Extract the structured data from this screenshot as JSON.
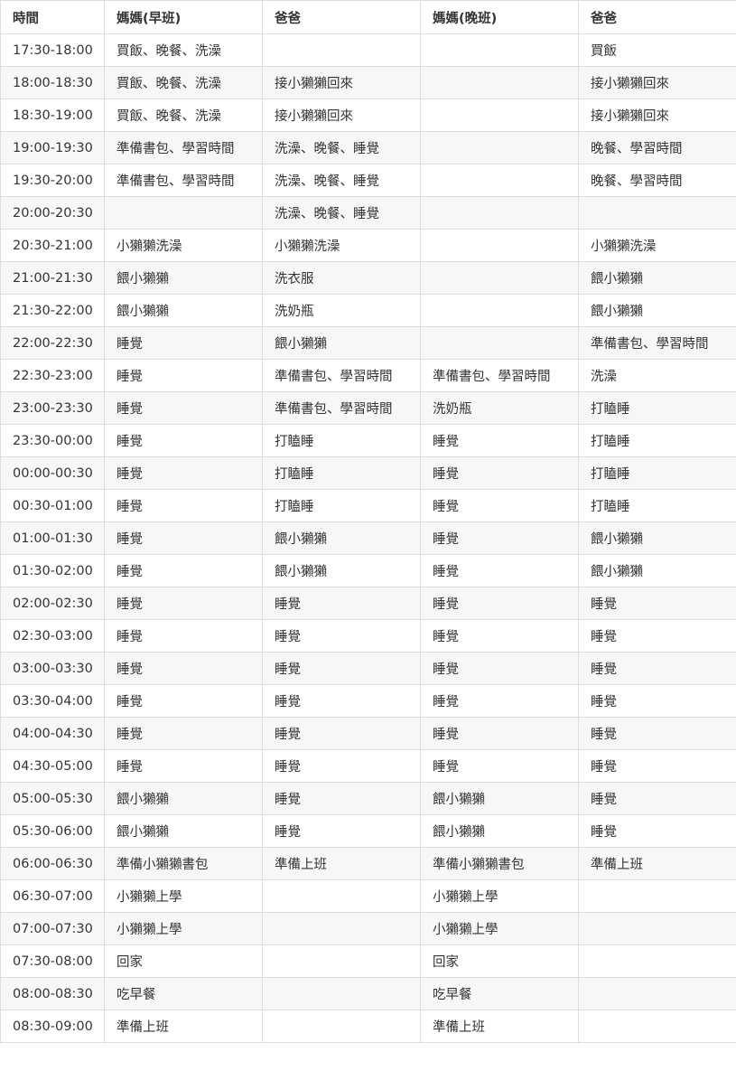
{
  "table": {
    "headers": [
      "時間",
      "媽媽(早班)",
      "爸爸",
      "媽媽(晚班)",
      "爸爸"
    ],
    "rows": [
      [
        "17:30-18:00",
        "買飯、晚餐、洗澡",
        "",
        "",
        "買飯"
      ],
      [
        "18:00-18:30",
        "買飯、晚餐、洗澡",
        "接小獺獺回來",
        "",
        "接小獺獺回來"
      ],
      [
        "18:30-19:00",
        "買飯、晚餐、洗澡",
        "接小獺獺回來",
        "",
        "接小獺獺回來"
      ],
      [
        "19:00-19:30",
        "準備書包、學習時間",
        "洗澡、晚餐、睡覺",
        "",
        "晚餐、學習時間"
      ],
      [
        "19:30-20:00",
        "準備書包、學習時間",
        "洗澡、晚餐、睡覺",
        "",
        "晚餐、學習時間"
      ],
      [
        "20:00-20:30",
        "",
        "洗澡、晚餐、睡覺",
        "",
        ""
      ],
      [
        "20:30-21:00",
        "小獺獺洗澡",
        "小獺獺洗澡",
        "",
        "小獺獺洗澡"
      ],
      [
        "21:00-21:30",
        "餵小獺獺",
        "洗衣服",
        "",
        "餵小獺獺"
      ],
      [
        "21:30-22:00",
        "餵小獺獺",
        "洗奶瓶",
        "",
        "餵小獺獺"
      ],
      [
        "22:00-22:30",
        "睡覺",
        "餵小獺獺",
        "",
        "準備書包、學習時間"
      ],
      [
        "22:30-23:00",
        "睡覺",
        "準備書包、學習時間",
        "準備書包、學習時間",
        "洗澡"
      ],
      [
        "23:00-23:30",
        "睡覺",
        "準備書包、學習時間",
        "洗奶瓶",
        "打瞌睡"
      ],
      [
        "23:30-00:00",
        "睡覺",
        "打瞌睡",
        "睡覺",
        "打瞌睡"
      ],
      [
        "00:00-00:30",
        "睡覺",
        "打瞌睡",
        "睡覺",
        "打瞌睡"
      ],
      [
        "00:30-01:00",
        "睡覺",
        "打瞌睡",
        "睡覺",
        "打瞌睡"
      ],
      [
        "01:00-01:30",
        "睡覺",
        "餵小獺獺",
        "睡覺",
        "餵小獺獺"
      ],
      [
        "01:30-02:00",
        "睡覺",
        "餵小獺獺",
        "睡覺",
        "餵小獺獺"
      ],
      [
        "02:00-02:30",
        "睡覺",
        "睡覺",
        "睡覺",
        "睡覺"
      ],
      [
        "02:30-03:00",
        "睡覺",
        "睡覺",
        "睡覺",
        "睡覺"
      ],
      [
        "03:00-03:30",
        "睡覺",
        "睡覺",
        "睡覺",
        "睡覺"
      ],
      [
        "03:30-04:00",
        "睡覺",
        "睡覺",
        "睡覺",
        "睡覺"
      ],
      [
        "04:00-04:30",
        "睡覺",
        "睡覺",
        "睡覺",
        "睡覺"
      ],
      [
        "04:30-05:00",
        "睡覺",
        "睡覺",
        "睡覺",
        "睡覺"
      ],
      [
        "05:00-05:30",
        "餵小獺獺",
        "睡覺",
        "餵小獺獺",
        "睡覺"
      ],
      [
        "05:30-06:00",
        "餵小獺獺",
        "睡覺",
        "餵小獺獺",
        "睡覺"
      ],
      [
        "06:00-06:30",
        "準備小獺獺書包",
        "準備上班",
        "準備小獺獺書包",
        "準備上班"
      ],
      [
        "06:30-07:00",
        "小獺獺上學",
        "",
        "小獺獺上學",
        ""
      ],
      [
        "07:00-07:30",
        "小獺獺上學",
        "",
        "小獺獺上學",
        ""
      ],
      [
        "07:30-08:00",
        "回家",
        "",
        "回家",
        ""
      ],
      [
        "08:00-08:30",
        "吃早餐",
        "",
        "吃早餐",
        ""
      ],
      [
        "08:30-09:00",
        "準備上班",
        "",
        "準備上班",
        ""
      ]
    ]
  }
}
